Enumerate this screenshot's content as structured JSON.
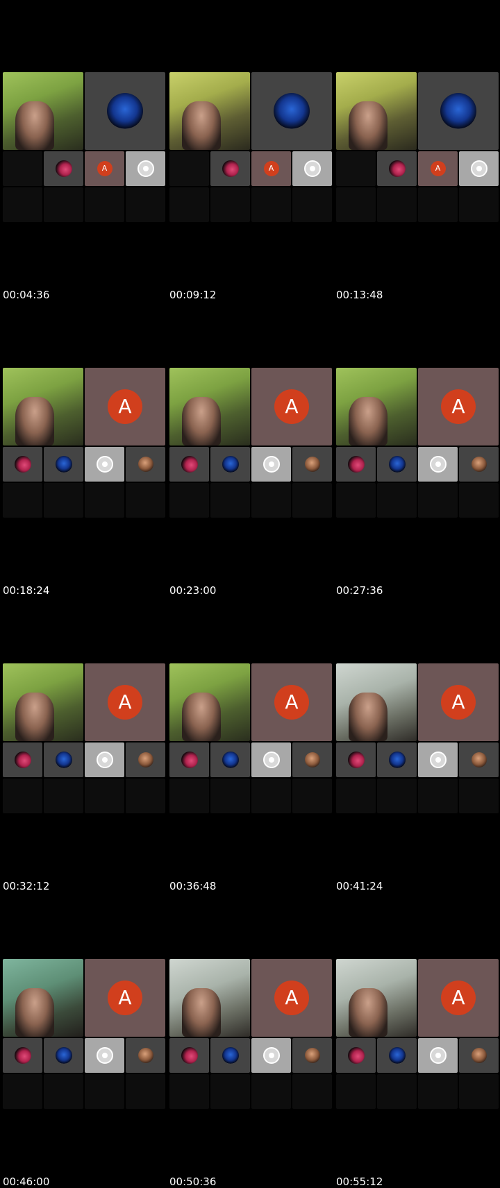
{
  "thumbnails": [
    {
      "timestamp": "00:04:36",
      "layout": "early",
      "camera": "green"
    },
    {
      "timestamp": "00:09:12",
      "layout": "early",
      "camera": "yellow"
    },
    {
      "timestamp": "00:13:48",
      "layout": "early",
      "camera": "yellow"
    },
    {
      "timestamp": "00:18:24",
      "layout": "late",
      "camera": "green"
    },
    {
      "timestamp": "00:23:00",
      "layout": "late",
      "camera": "green"
    },
    {
      "timestamp": "00:27:36",
      "layout": "late",
      "camera": "green"
    },
    {
      "timestamp": "00:32:12",
      "layout": "late",
      "camera": "green"
    },
    {
      "timestamp": "00:36:48",
      "layout": "late",
      "camera": "green"
    },
    {
      "timestamp": "00:41:24",
      "layout": "late",
      "camera": "pale"
    },
    {
      "timestamp": "00:46:00",
      "layout": "late",
      "camera": "teal"
    },
    {
      "timestamp": "00:50:36",
      "layout": "late",
      "camera": "pale"
    },
    {
      "timestamp": "00:55:12",
      "layout": "late",
      "camera": "pale"
    }
  ],
  "avatar_letter": "A",
  "colors": {
    "background": "#000000",
    "avatar_red": "#d13f1d",
    "avatar_tile": "#6d5656",
    "tile_grey": "#444444"
  }
}
